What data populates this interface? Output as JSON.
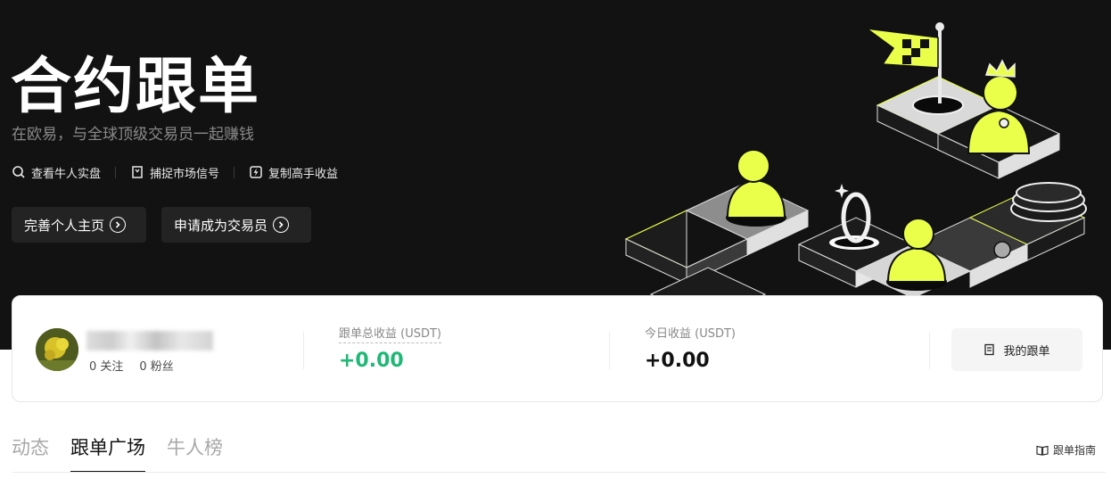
{
  "hero": {
    "title": "合约跟单",
    "subtitle": "在欧易，与全球顶级交易员一起赚钱",
    "features": [
      {
        "icon": "search-icon",
        "label": "查看牛人实盘"
      },
      {
        "icon": "bookmark-icon",
        "label": "捕捉市场信号"
      },
      {
        "icon": "lightning-icon",
        "label": "复制高手收益"
      }
    ],
    "buttons": {
      "complete_profile": "完善个人主页",
      "apply_trader": "申请成为交易员"
    }
  },
  "profile": {
    "following": "0 关注",
    "followers": "0 粉丝",
    "total_label": "跟单总收益 (USDT)",
    "total_value": "+0.00",
    "today_label": "今日收益 (USDT)",
    "today_value": "+0.00",
    "my_copy_label": "我的跟单"
  },
  "tabs": [
    {
      "label": "动态",
      "active": false
    },
    {
      "label": "跟单广场",
      "active": true
    },
    {
      "label": "牛人榜",
      "active": false
    }
  ],
  "guide_label": "跟单指南",
  "colors": {
    "accent_yellow": "#eaff4a",
    "profit_green": "#1fb876",
    "hero_bg": "#121212"
  }
}
